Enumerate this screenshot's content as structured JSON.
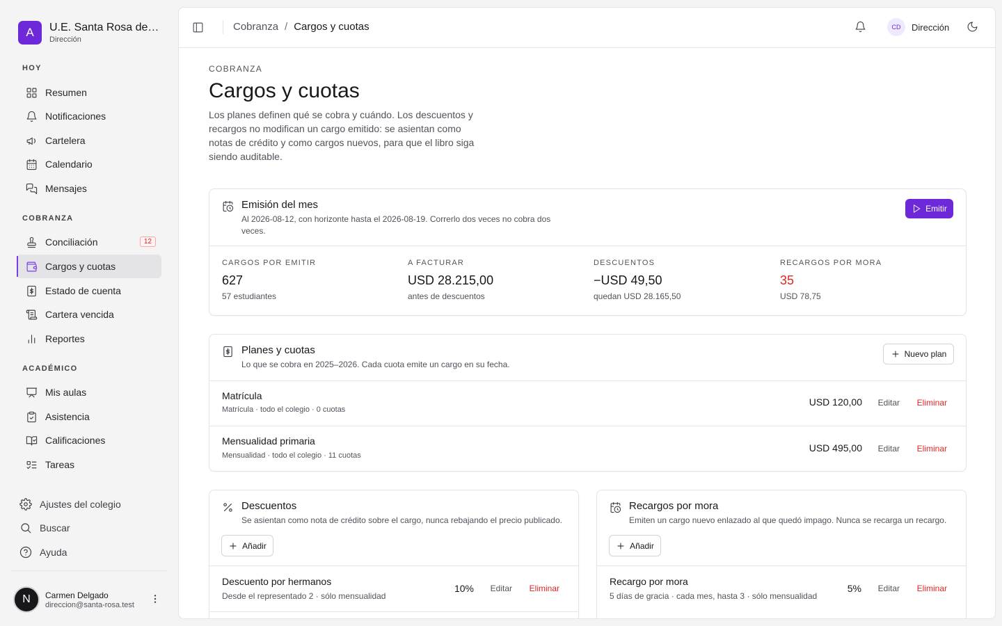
{
  "brand": {
    "logo_letter": "A",
    "name": "U.E. Santa Rosa de Lima",
    "role": "Dirección"
  },
  "sidebar": {
    "sections": {
      "hoy": "HOY",
      "cobranza": "COBRANZA",
      "academico": "ACADÉMICO"
    },
    "hoy": [
      {
        "label": "Resumen",
        "icon": "grid-icon"
      },
      {
        "label": "Notificaciones",
        "icon": "bell-icon"
      },
      {
        "label": "Cartelera",
        "icon": "megaphone-icon"
      },
      {
        "label": "Calendario",
        "icon": "calendar-icon"
      },
      {
        "label": "Mensajes",
        "icon": "messages-icon"
      }
    ],
    "cobranza": [
      {
        "label": "Conciliación",
        "icon": "stamp-icon",
        "badge": "12"
      },
      {
        "label": "Cargos y cuotas",
        "icon": "wallet-icon",
        "active": true
      },
      {
        "label": "Estado de cuenta",
        "icon": "receipt-icon"
      },
      {
        "label": "Cartera vencida",
        "icon": "scroll-icon"
      },
      {
        "label": "Reportes",
        "icon": "bar-chart-icon"
      }
    ],
    "academico": [
      {
        "label": "Mis aulas",
        "icon": "presentation-icon"
      },
      {
        "label": "Asistencia",
        "icon": "clipboard-check-icon"
      },
      {
        "label": "Calificaciones",
        "icon": "book-check-icon"
      },
      {
        "label": "Tareas",
        "icon": "list-todo-icon"
      }
    ],
    "utility": [
      {
        "label": "Ajustes del colegio",
        "icon": "gear-icon"
      },
      {
        "label": "Buscar",
        "icon": "search-icon"
      },
      {
        "label": "Ayuda",
        "icon": "help-icon"
      }
    ],
    "user": {
      "initial": "N",
      "name": "Carmen Delgado",
      "email": "direccion@santa-rosa.test"
    }
  },
  "topbar": {
    "crumbs": [
      "Cobranza",
      "Cargos y cuotas"
    ],
    "separator": "/",
    "user_initials": "CD",
    "user_label": "Dirección"
  },
  "page": {
    "eyebrow": "COBRANZA",
    "title": "Cargos y cuotas",
    "description": "Los planes definen qué se cobra y cuándo. Los descuentos y recargos no modifican un cargo emitido: se asientan como notas de crédito y como cargos nuevos, para que el libro siga siendo auditable."
  },
  "emision": {
    "title": "Emisión del mes",
    "subtitle": "Al 2026-08-12, con horizonte hasta el 2026-08-19. Correrlo dos veces no cobra dos veces.",
    "button": "Emitir",
    "stats": [
      {
        "label": "CARGOS POR EMITIR",
        "value": "627",
        "sub": "57 estudiantes"
      },
      {
        "label": "A FACTURAR",
        "value": "USD 28.215,00",
        "sub": "antes de descuentos"
      },
      {
        "label": "DESCUENTOS",
        "value": "−USD 49,50",
        "sub": "quedan USD 28.165,50"
      },
      {
        "label": "RECARGOS POR MORA",
        "value": "35",
        "sub": "USD 78,75",
        "alert": true
      }
    ]
  },
  "planes": {
    "title": "Planes y cuotas",
    "subtitle": "Lo que se cobra en 2025–2026. Cada cuota emite un cargo en su fecha.",
    "button": "Nuevo plan",
    "rows": [
      {
        "name": "Matrícula",
        "meta": "Matrícula · todo el colegio · 0 cuotas",
        "amount": "USD 120,00",
        "edit": "Editar",
        "delete": "Eliminar"
      },
      {
        "name": "Mensualidad primaria",
        "meta": "Mensualidad · todo el colegio · 11 cuotas",
        "amount": "USD 495,00",
        "edit": "Editar",
        "delete": "Eliminar"
      }
    ]
  },
  "descuentos": {
    "title": "Descuentos",
    "subtitle": "Se asientan como nota de crédito sobre el cargo, nunca rebajando el precio publicado.",
    "button": "Añadir",
    "rows": [
      {
        "name": "Descuento por hermanos",
        "meta": "Desde el representado 2 · sólo mensualidad",
        "amount": "10%",
        "edit": "Editar",
        "delete": "Eliminar"
      }
    ]
  },
  "recargos": {
    "title": "Recargos por mora",
    "subtitle": "Emiten un cargo nuevo enlazado al que quedó impago. Nunca se recarga un recargo.",
    "button": "Añadir",
    "rows": [
      {
        "name": "Recargo por mora",
        "meta": "5 días de gracia · cada mes, hasta 3 · sólo mensualidad",
        "amount": "5%",
        "edit": "Editar",
        "delete": "Eliminar"
      }
    ]
  },
  "colors": {
    "accent": "#6d28d9",
    "danger": "#dc2626",
    "badge_bg": "#fef2f2"
  }
}
